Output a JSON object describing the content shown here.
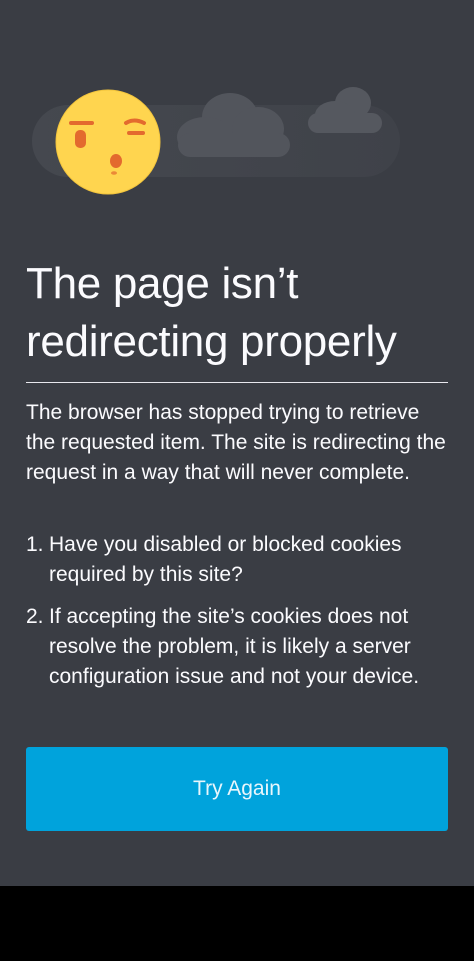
{
  "error_page": {
    "title": "The page isn’t redirecting properly",
    "description": "The browser has stopped trying to retrieve the requested item. The site is redirecting the request in a way that will never complete.",
    "steps": [
      {
        "number": "1.",
        "text": "Have you disabled or blocked cookies required by this site?"
      },
      {
        "number": "2.",
        "text": "If accepting the site’s cookies does not resolve the problem, it is likely a server configuration issue and not your device."
      }
    ],
    "try_again_label": "Try Again",
    "illustration_icon": "confused-face-with-clouds-icon"
  },
  "colors": {
    "background": "#3a3d44",
    "accent": "#00a3dc",
    "face": "#ffd54f",
    "face_features": "#e36a2e",
    "cloud": "#4c4f56",
    "pill": "#43464d"
  }
}
